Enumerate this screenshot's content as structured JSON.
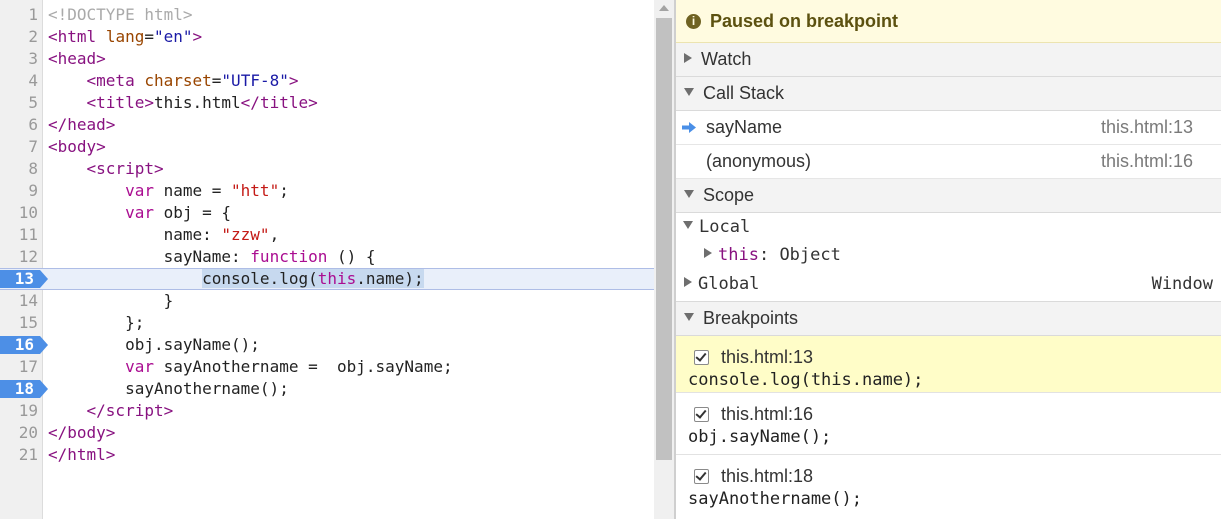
{
  "editor": {
    "lines": [
      {
        "n": "1",
        "html": "<span class='t-doc'>&lt;!DOCTYPE html&gt;</span>"
      },
      {
        "n": "2",
        "html": "<span class='t-tag'>&lt;html</span> <span class='t-attr'>lang</span>=<span class='t-val'>\"en\"</span><span class='t-tag'>&gt;</span>"
      },
      {
        "n": "3",
        "html": "<span class='t-tag'>&lt;head&gt;</span>"
      },
      {
        "n": "4",
        "html": "    <span class='t-tag'>&lt;meta</span> <span class='t-attr'>charset</span>=<span class='t-val'>\"UTF-8\"</span><span class='t-tag'>&gt;</span>"
      },
      {
        "n": "5",
        "html": "    <span class='t-tag'>&lt;title&gt;</span>this.html<span class='t-tag'>&lt;/title&gt;</span>"
      },
      {
        "n": "6",
        "html": "<span class='t-tag'>&lt;/head&gt;</span>"
      },
      {
        "n": "7",
        "html": "<span class='t-tag'>&lt;body&gt;</span>"
      },
      {
        "n": "8",
        "html": "    <span class='t-tag'>&lt;script&gt;</span>"
      },
      {
        "n": "9",
        "html": "        <span class='t-kw'>var</span> name = <span class='t-str'>\"htt\"</span>;"
      },
      {
        "n": "10",
        "html": "        <span class='t-kw'>var</span> obj = {"
      },
      {
        "n": "11",
        "html": "            name: <span class='t-str'>\"zzw\"</span>,"
      },
      {
        "n": "12",
        "html": "            sayName: <span class='t-kw'>function</span> () {"
      },
      {
        "n": "13",
        "html": "                <span class='sel'>console.log(<span class='t-kw'>this</span>.name);</span>",
        "bp": true,
        "current": true
      },
      {
        "n": "14",
        "html": "            }"
      },
      {
        "n": "15",
        "html": "        };"
      },
      {
        "n": "16",
        "html": "        obj.sayName();",
        "bp": true
      },
      {
        "n": "17",
        "html": "        <span class='t-kw'>var</span> sayAnothername =  obj.sayName;"
      },
      {
        "n": "18",
        "html": "        sayAnothername();",
        "bp": true
      },
      {
        "n": "19",
        "html": "    <span class='t-tag'>&lt;/script&gt;</span>"
      },
      {
        "n": "20",
        "html": "<span class='t-tag'>&lt;/body&gt;</span>"
      },
      {
        "n": "21",
        "html": "<span class='t-tag'>&lt;/html&gt;</span>"
      }
    ]
  },
  "sidebar": {
    "paused_text": "Paused on breakpoint",
    "watch_label": "Watch",
    "call_stack_label": "Call Stack",
    "call_stack": [
      {
        "name": "sayName",
        "location": "this.html:13",
        "current": true
      },
      {
        "name": "(anonymous)",
        "location": "this.html:16",
        "current": false
      }
    ],
    "scope_label": "Scope",
    "scope": {
      "local_label": "Local",
      "this_key": "this",
      "this_value": "Object",
      "global_label": "Global",
      "global_value": "Window"
    },
    "breakpoints_label": "Breakpoints",
    "breakpoints": [
      {
        "location": "this.html:13",
        "code": "console.log(this.name);",
        "active": true
      },
      {
        "location": "this.html:16",
        "code": "obj.sayName();",
        "active": false
      },
      {
        "location": "this.html:18",
        "code": "sayAnothername();",
        "active": false
      }
    ]
  },
  "colors": {
    "breakpoint_marker": "#4d8fe6",
    "paused_banner": "#fffbe0",
    "active_breakpoint": "#fffdc8"
  },
  "icons": {
    "paused": "info-icon",
    "current_frame": "arrow-right-icon",
    "section_collapsed": "triangle-right-icon",
    "section_expanded": "triangle-down-icon",
    "breakpoint_checkbox": "checkbox-checked-icon"
  }
}
